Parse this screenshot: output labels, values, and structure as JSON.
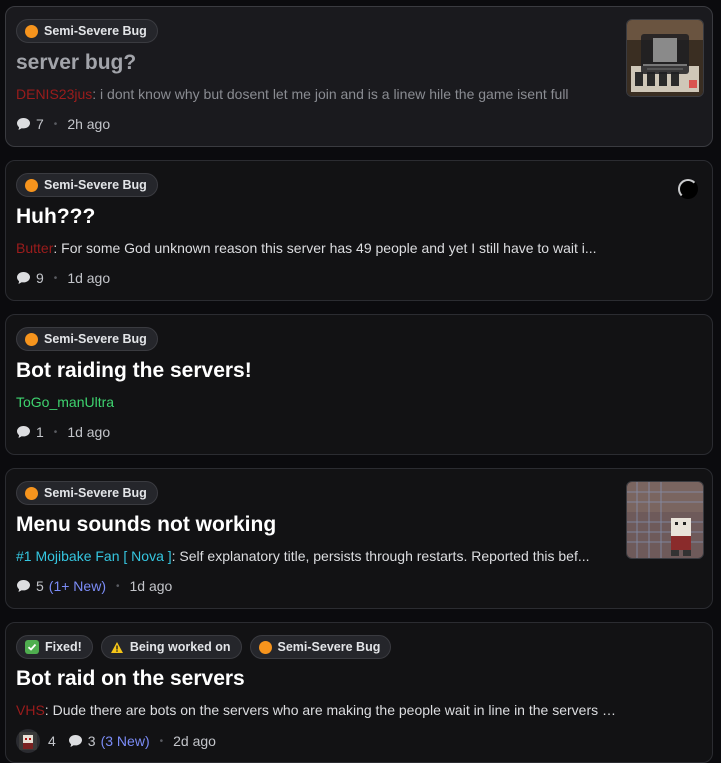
{
  "posts": [
    {
      "tags": [
        "Semi-Severe Bug"
      ],
      "title": "server bug?",
      "author": "DENIS23jus",
      "author_color": "#9b1c1c",
      "preview": "i dont know why but dosent let me join and is a linew hile the game isent full",
      "replies": "7",
      "time": "2h ago",
      "thumbnail": "image"
    },
    {
      "tags": [
        "Semi-Severe Bug"
      ],
      "title": "Huh???",
      "author": "Butter",
      "author_color": "#9b1c1c",
      "preview": "For some God unknown reason this server has 49 people and yet I still have to wait i...",
      "replies": "9",
      "time": "1d ago",
      "thumbnail": "loading"
    },
    {
      "tags": [
        "Semi-Severe Bug"
      ],
      "title": "Bot raiding the servers!",
      "author": "ToGo_manUltra",
      "author_color": "#3ed36f",
      "preview": "",
      "replies": "1",
      "time": "1d ago"
    },
    {
      "tags": [
        "Semi-Severe Bug"
      ],
      "title": "Menu sounds not working",
      "author": "#1 Mojibake Fan [ Nova ]",
      "author_color": "#35c6e0",
      "preview": "Self explanatory title, persists through restarts. Reported this bef...",
      "replies": "5",
      "new_replies": "(1+ New)",
      "time": "1d ago",
      "thumbnail": "image"
    },
    {
      "tags": [
        "Fixed!",
        "Being worked on",
        "Semi-Severe Bug"
      ],
      "title": "Bot raid on the servers",
      "author": "VHS",
      "author_color": "#9b1c1c",
      "preview": "Dude there are bots on the servers who are making the people wait in line in the servers Reset the s...",
      "reactions": "4",
      "replies": "3",
      "new_replies": "(3 New)",
      "time": "2d ago"
    }
  ],
  "colors": {
    "semi_severe": "#f6941d",
    "fixed": "#4fae4f",
    "new": "#7b8cf7"
  },
  "icons": {
    "reply": "speech-bubble-icon",
    "severity": "orange-circle-icon",
    "fixed": "check-mark-icon",
    "in_progress": "warning-icon"
  }
}
